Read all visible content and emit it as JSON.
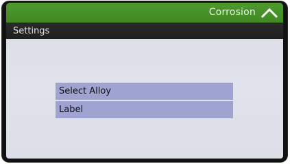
{
  "header": {
    "title": "Corrosion",
    "up_icon": "chevron-up-icon"
  },
  "subheader": {
    "title": "Settings"
  },
  "menu": {
    "items": [
      {
        "label": "Select Alloy"
      },
      {
        "label": "Label"
      }
    ]
  },
  "colors": {
    "header_green": "#479326",
    "subheader_dark": "#242424",
    "screen_bg": "#dfe1ea",
    "menu_item_bg": "#9ea3d1"
  }
}
